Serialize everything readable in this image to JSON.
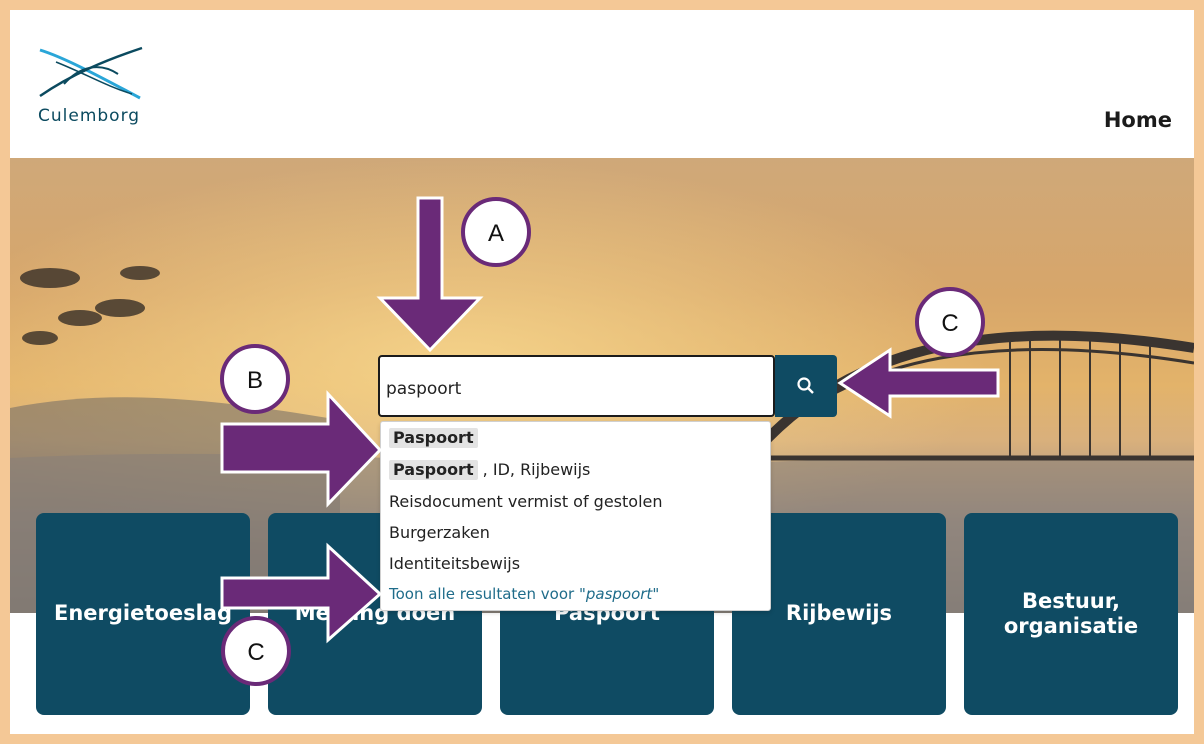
{
  "header": {
    "logo_text": "Culemborg",
    "nav_home": "Home"
  },
  "search": {
    "value": "paspoort",
    "button_icon": "search-icon"
  },
  "suggestions": {
    "items": [
      {
        "highlight": "Paspoort",
        "rest": ""
      },
      {
        "highlight": "Paspoort",
        "rest": " , ID, Rijbewijs"
      },
      {
        "highlight": "",
        "rest": "Reisdocument vermist of gestolen"
      },
      {
        "highlight": "",
        "rest": "Burgerzaken"
      },
      {
        "highlight": "",
        "rest": "Identiteitsbewijs"
      }
    ],
    "show_all_prefix": "Toon alle resultaten voor \"",
    "show_all_term": "paspoort",
    "show_all_suffix": "\""
  },
  "tiles": [
    {
      "label_line1": "Energietoeslag",
      "label_line2": ""
    },
    {
      "label_line1": "Melding doen",
      "label_line2": ""
    },
    {
      "label_line1": "Paspoort",
      "label_line2": ""
    },
    {
      "label_line1": "Rijbewijs",
      "label_line2": ""
    },
    {
      "label_line1": "Bestuur,",
      "label_line2": "organisatie"
    }
  ],
  "annotations": {
    "badge_a": "A",
    "badge_b": "B",
    "badge_c_top": "C",
    "badge_c_bottom": "C",
    "arrow_color": "#6a2a78",
    "badge_border": "#6a2a78"
  },
  "colors": {
    "frame_border": "#f4c896",
    "brand_teal": "#0f4b63",
    "link_blue": "#1f6c8a"
  }
}
